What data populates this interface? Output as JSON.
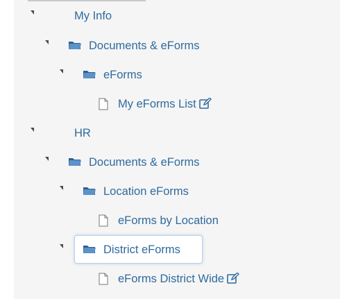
{
  "tree": {
    "items": [
      {
        "label": "My Info"
      },
      {
        "label": "Documents & eForms"
      },
      {
        "label": "eForms"
      },
      {
        "label": "My eForms List"
      },
      {
        "label": "HR"
      },
      {
        "label": "Documents & eForms"
      },
      {
        "label": "Location eForms"
      },
      {
        "label": "eForms by Location"
      },
      {
        "label": "District eForms"
      },
      {
        "label": "eForms District Wide"
      }
    ]
  },
  "colors": {
    "link": "#2f6a9e",
    "panel_bg": "#f5f5f5",
    "folder": "#4a7fb5",
    "selection_border": "#b7d2ea"
  },
  "icons": {
    "expand": "triangle-down-icon",
    "folder": "folder-open-icon",
    "document": "document-icon",
    "edit": "edit-icon"
  }
}
